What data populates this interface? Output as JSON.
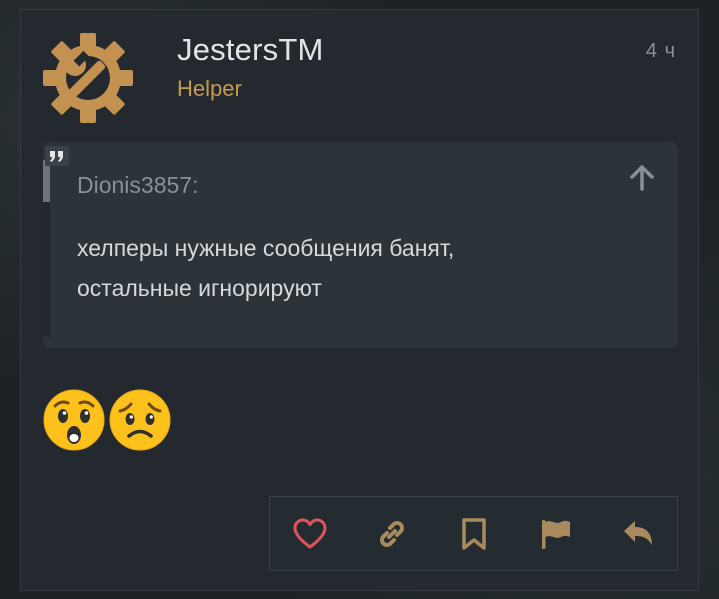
{
  "post": {
    "author": "JestersTM",
    "role": "Helper",
    "time": "4 ч",
    "quote": {
      "author": "Dionis3857:",
      "lines": [
        "хелперы нужные сообщения банят,",
        "остальные игнорируют"
      ]
    },
    "reactions": [
      {
        "icon": "hushed-face-emoji"
      },
      {
        "icon": "worried-face-emoji"
      }
    ]
  },
  "actions": [
    {
      "icon": "heart-icon",
      "color": "#e0555c"
    },
    {
      "icon": "link-icon",
      "color": "#a88a5c"
    },
    {
      "icon": "bookmark-icon",
      "color": "#a88a5c"
    },
    {
      "icon": "flag-icon",
      "color": "#a88a5c"
    },
    {
      "icon": "reply-icon",
      "color": "#a88a5c"
    }
  ],
  "colors": {
    "accent": "#c59a52",
    "background": "#23292e",
    "quote_background": "#2c343a",
    "text": "#d6d8da"
  }
}
